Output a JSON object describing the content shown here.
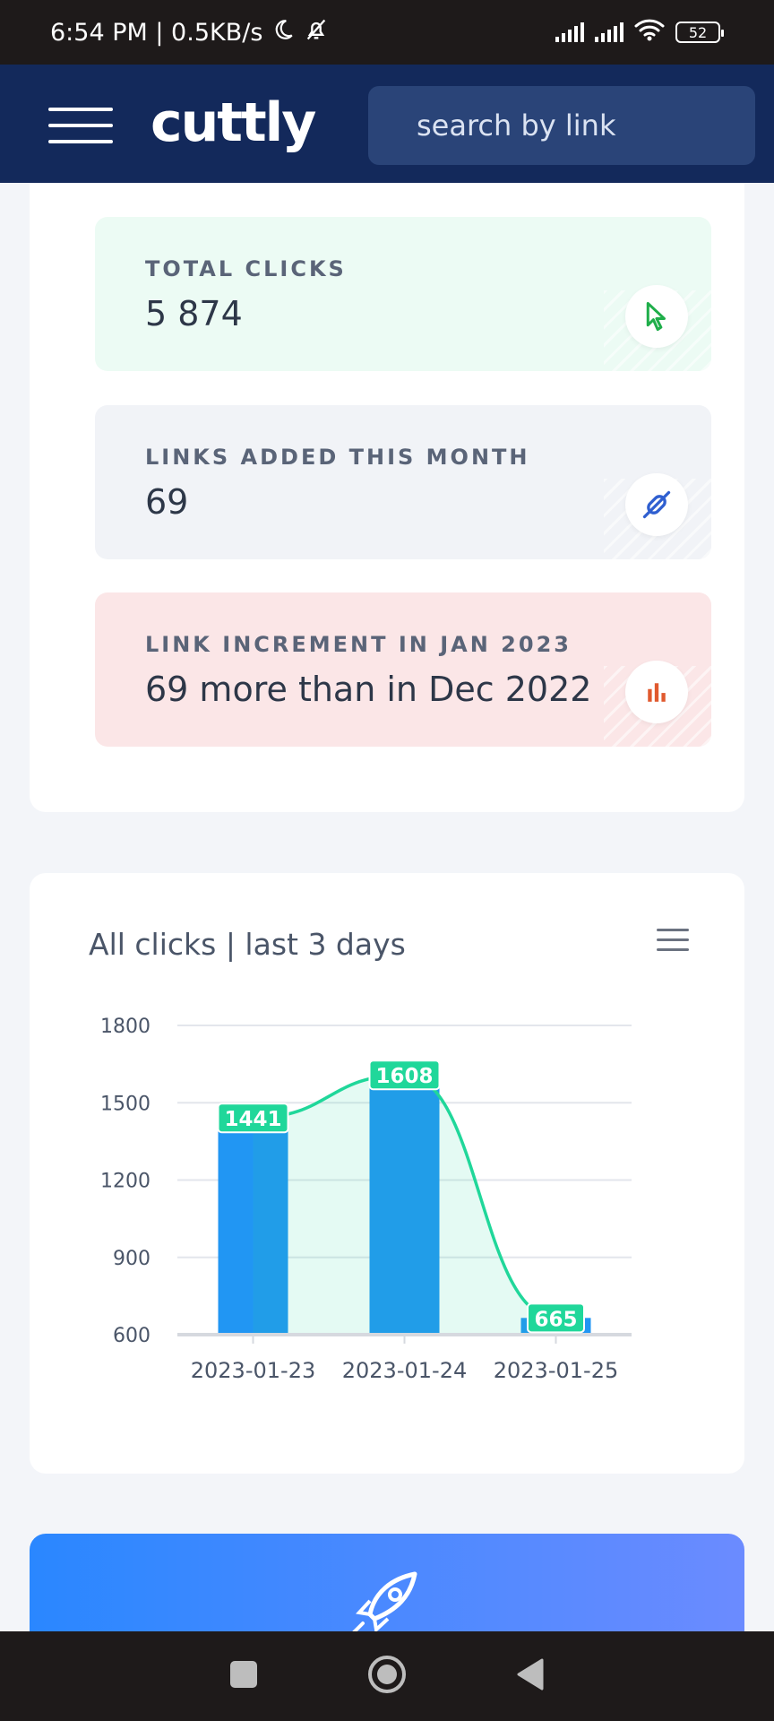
{
  "status_bar": {
    "time": "6:54 PM | 0.5KB/s",
    "battery": "52"
  },
  "header": {
    "logo": "cuttly",
    "search_placeholder": "search by link"
  },
  "stats": [
    {
      "label": "TOTAL CLICKS",
      "value": "5 874",
      "icon": "cursor-icon",
      "color": "#1fae4a"
    },
    {
      "label": "LINKS ADDED THIS MONTH",
      "value": "69",
      "icon": "link-icon",
      "color": "#2f5fd0"
    },
    {
      "label": "LINK INCREMENT IN JAN 2023",
      "value": "69 more than in Dec 2022",
      "icon": "bar-chart-icon",
      "color": "#e0592e"
    }
  ],
  "chart_card": {
    "title": "All clicks | last 3 days"
  },
  "chart_data": {
    "type": "bar",
    "categories": [
      "2023-01-23",
      "2023-01-24",
      "2023-01-25"
    ],
    "series": [
      {
        "type": "bar",
        "values": [
          1441,
          1608,
          665
        ],
        "color": "#2196f3"
      },
      {
        "type": "area",
        "values": [
          1441,
          1608,
          665
        ],
        "color": "#20d79a"
      }
    ],
    "data_labels": [
      "1441",
      "1608",
      "665"
    ],
    "yticks": [
      "1800",
      "1500",
      "1200",
      "900",
      "600"
    ],
    "ylim": [
      600,
      1800
    ],
    "grid": true
  },
  "colors": {
    "header_bg": "#13295b",
    "bar": "#2196f3",
    "line": "#20d79a"
  }
}
